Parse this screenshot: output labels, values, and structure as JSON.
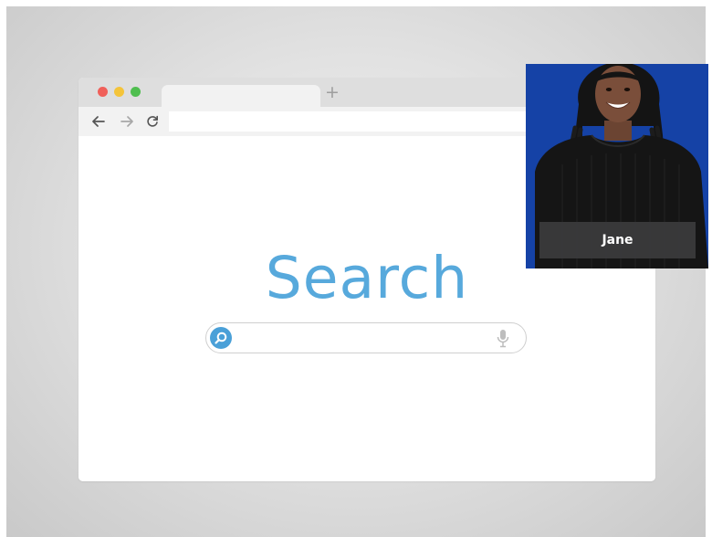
{
  "browser": {
    "window_controls": [
      "close",
      "minimize",
      "maximize"
    ],
    "new_tab_label": "+",
    "nav": {
      "back_icon": "arrow-left-icon",
      "forward_icon": "arrow-right-icon",
      "reload_icon": "reload-icon"
    },
    "url_value": ""
  },
  "search_page": {
    "logo_text": "Search",
    "search_input_value": "",
    "search_icon": "search-icon",
    "mic_icon": "microphone-icon",
    "accent_color": "#57a9dc"
  },
  "presenter": {
    "name": "Jane",
    "background_color": "#1542a6"
  }
}
